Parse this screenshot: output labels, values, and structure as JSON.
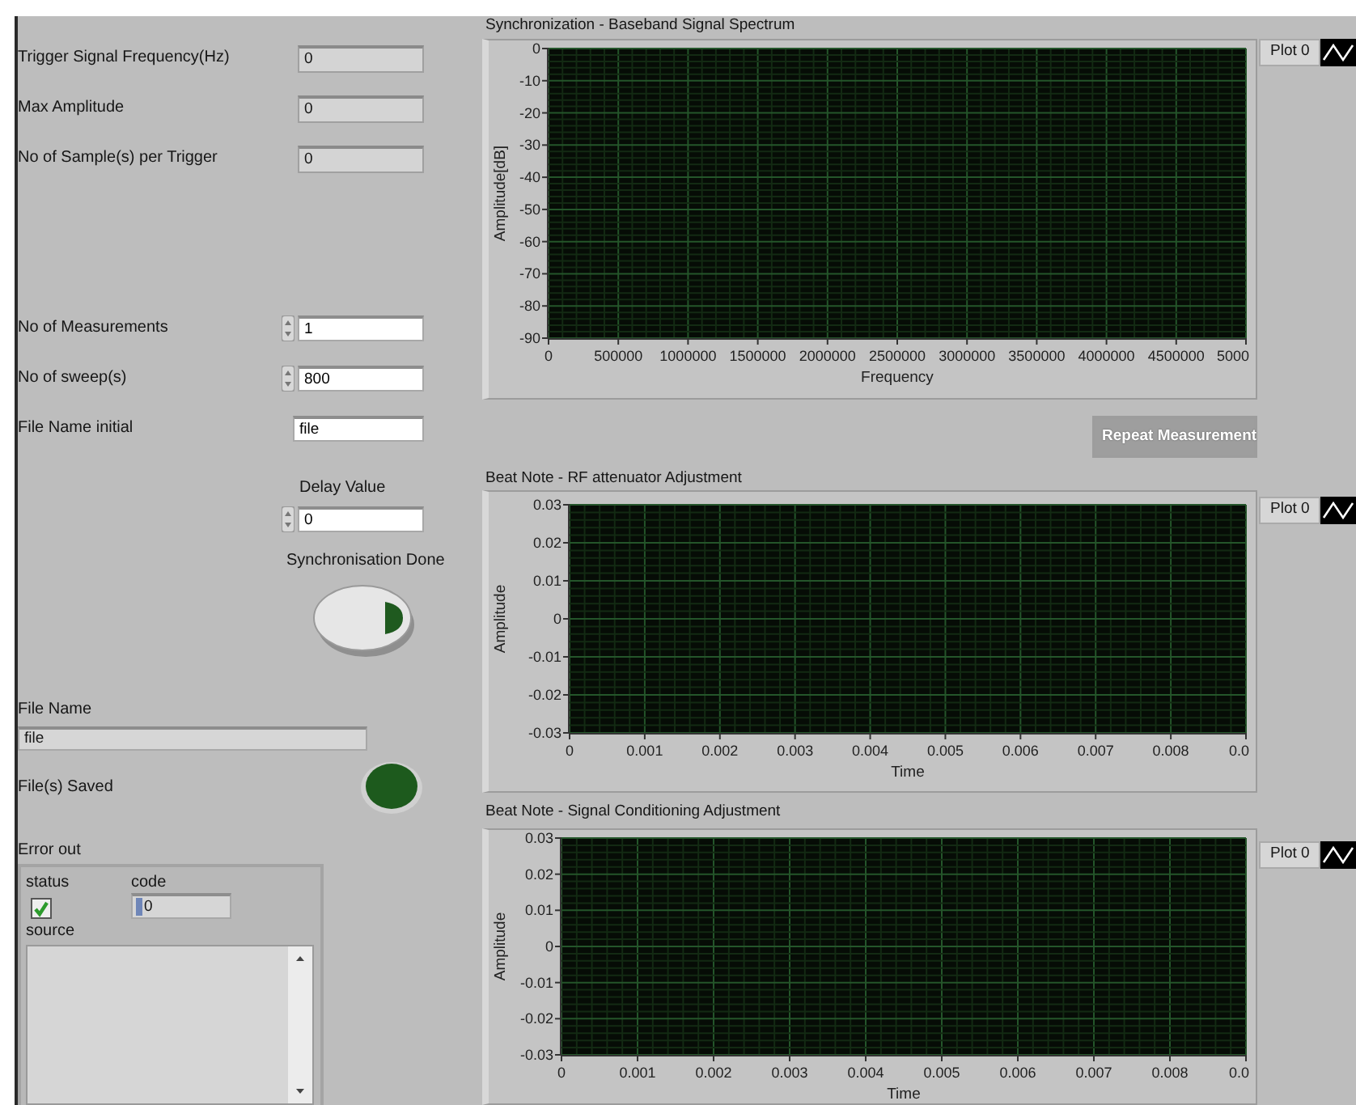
{
  "left_panel": {
    "fields": [
      {
        "kind": "indicator",
        "label": "Trigger Signal Frequency(Hz)",
        "value": "0"
      },
      {
        "kind": "indicator",
        "label": "Max Amplitude",
        "value": "0"
      },
      {
        "kind": "indicator",
        "label": "No of Sample(s) per Trigger",
        "value": "0"
      },
      {
        "kind": "numeric",
        "label": "No of Measurements",
        "value": "1"
      },
      {
        "kind": "numeric",
        "label": "No of sweep(s)",
        "value": "800"
      },
      {
        "kind": "string",
        "label": "File Name initial",
        "value": "file"
      }
    ],
    "delay": {
      "label": "Delay Value",
      "value": "0"
    },
    "sync_button": {
      "label": "Synchronisation Done",
      "on": false
    },
    "file_name": {
      "label": "File Name",
      "value": "file"
    },
    "files_saved": {
      "label": "File(s) Saved",
      "on": false
    },
    "error_out": {
      "title": "Error out",
      "status_label": "status",
      "status_checked": true,
      "code_label": "code",
      "code": "0",
      "source_label": "source"
    }
  },
  "graphs": [
    {
      "chart_data": {
        "type": "line",
        "title": "Synchronization  - Baseband Signal Spectrum",
        "xlabel": "Frequency",
        "ylabel": "Amplitude[dB]",
        "grid": true,
        "categories": [
          "0",
          "500000",
          "1000000",
          "1500000",
          "2000000",
          "2500000",
          "3000000",
          "3500000",
          "4000000",
          "4500000",
          "5000"
        ],
        "ylim": [
          -90,
          0
        ],
        "yticks": [
          0,
          -10,
          -20,
          -30,
          -40,
          -50,
          -60,
          -70,
          -80,
          -90
        ],
        "series": [
          {
            "name": "Plot 0",
            "color": "#ffffff",
            "values": [
              null,
              null,
              null,
              null,
              null,
              null,
              null,
              null,
              null,
              null,
              null
            ]
          }
        ]
      }
    },
    {
      "chart_data": {
        "type": "line",
        "title": "Beat Note - RF attenuator Adjustment",
        "xlabel": "Time",
        "ylabel": "Amplitude",
        "grid": true,
        "categories": [
          "0",
          "0.001",
          "0.002",
          "0.003",
          "0.004",
          "0.005",
          "0.006",
          "0.007",
          "0.008",
          "0.0"
        ],
        "ylim": [
          -0.03,
          0.03
        ],
        "yticks": [
          0.03,
          0.02,
          0.01,
          0,
          -0.01,
          -0.02,
          -0.03
        ],
        "series": [
          {
            "name": "Plot 0",
            "color": "#ffffff",
            "values": [
              null,
              null,
              null,
              null,
              null,
              null,
              null,
              null,
              null,
              null
            ]
          }
        ]
      }
    },
    {
      "chart_data": {
        "type": "line",
        "title": "Beat Note - Signal Conditioning Adjustment",
        "xlabel": "Time",
        "ylabel": "Amplitude",
        "grid": true,
        "categories": [
          "0",
          "0.001",
          "0.002",
          "0.003",
          "0.004",
          "0.005",
          "0.006",
          "0.007",
          "0.008",
          "0.0"
        ],
        "ylim": [
          -0.03,
          0.03
        ],
        "yticks": [
          0.03,
          0.02,
          0.01,
          0,
          -0.01,
          -0.02,
          -0.03
        ],
        "series": [
          {
            "name": "Plot 0",
            "color": "#ffffff",
            "values": [
              null,
              null,
              null,
              null,
              null,
              null,
              null,
              null,
              null,
              null
            ]
          }
        ]
      }
    }
  ],
  "repeat_button": {
    "label": "Repeat Measurement",
    "disabled": true
  }
}
